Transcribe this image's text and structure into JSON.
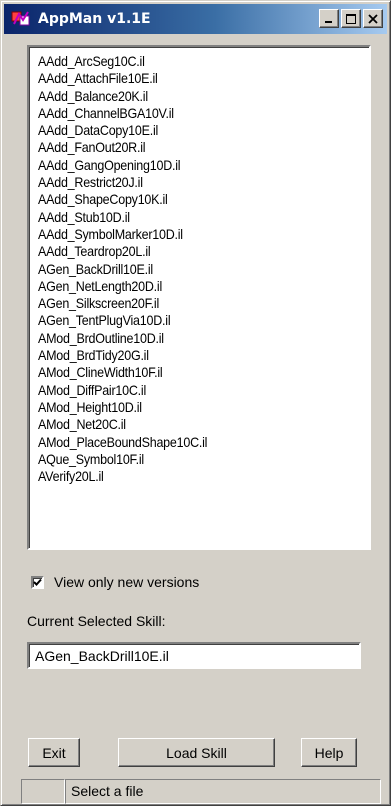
{
  "window": {
    "title": "AppMan v1.1E",
    "icon": "appman-app-icon",
    "controls": [
      "minimize-icon",
      "maximize-icon",
      "close-icon"
    ]
  },
  "file_list": {
    "items": [
      "AAdd_ArcSeg10C.il",
      "AAdd_AttachFile10E.il",
      "AAdd_Balance20K.il",
      "AAdd_ChannelBGA10V.il",
      "AAdd_DataCopy10E.il",
      "AAdd_FanOut20R.il",
      "AAdd_GangOpening10D.il",
      "AAdd_Restrict20J.il",
      "AAdd_ShapeCopy10K.il",
      "AAdd_Stub10D.il",
      "AAdd_SymbolMarker10D.il",
      "AAdd_Teardrop20L.il",
      "AGen_BackDrill10E.il",
      "AGen_NetLength20D.il",
      "AGen_Silkscreen20F.il",
      "AGen_TentPlugVia10D.il",
      "AMod_BrdOutline10D.il",
      "AMod_BrdTidy20G.il",
      "AMod_ClineWidth10F.il",
      "AMod_DiffPair10C.il",
      "AMod_Height10D.il",
      "AMod_Net20C.il",
      "AMod_PlaceBoundShape10C.il",
      "AQue_Symbol10F.il",
      "AVerify20L.il"
    ]
  },
  "options": {
    "view_only_new_label": "View only new versions",
    "view_only_new_checked": true
  },
  "current": {
    "label": "Current Selected Skill:",
    "value": "AGen_BackDrill10E.il"
  },
  "buttons": {
    "exit": "Exit",
    "load": "Load Skill",
    "help": "Help"
  },
  "status": {
    "pane1": "",
    "message": "Select a file"
  },
  "colors": {
    "face": "#d4d0c8",
    "title_gradient_start": "#0a246a",
    "title_gradient_end": "#a6caf0"
  }
}
